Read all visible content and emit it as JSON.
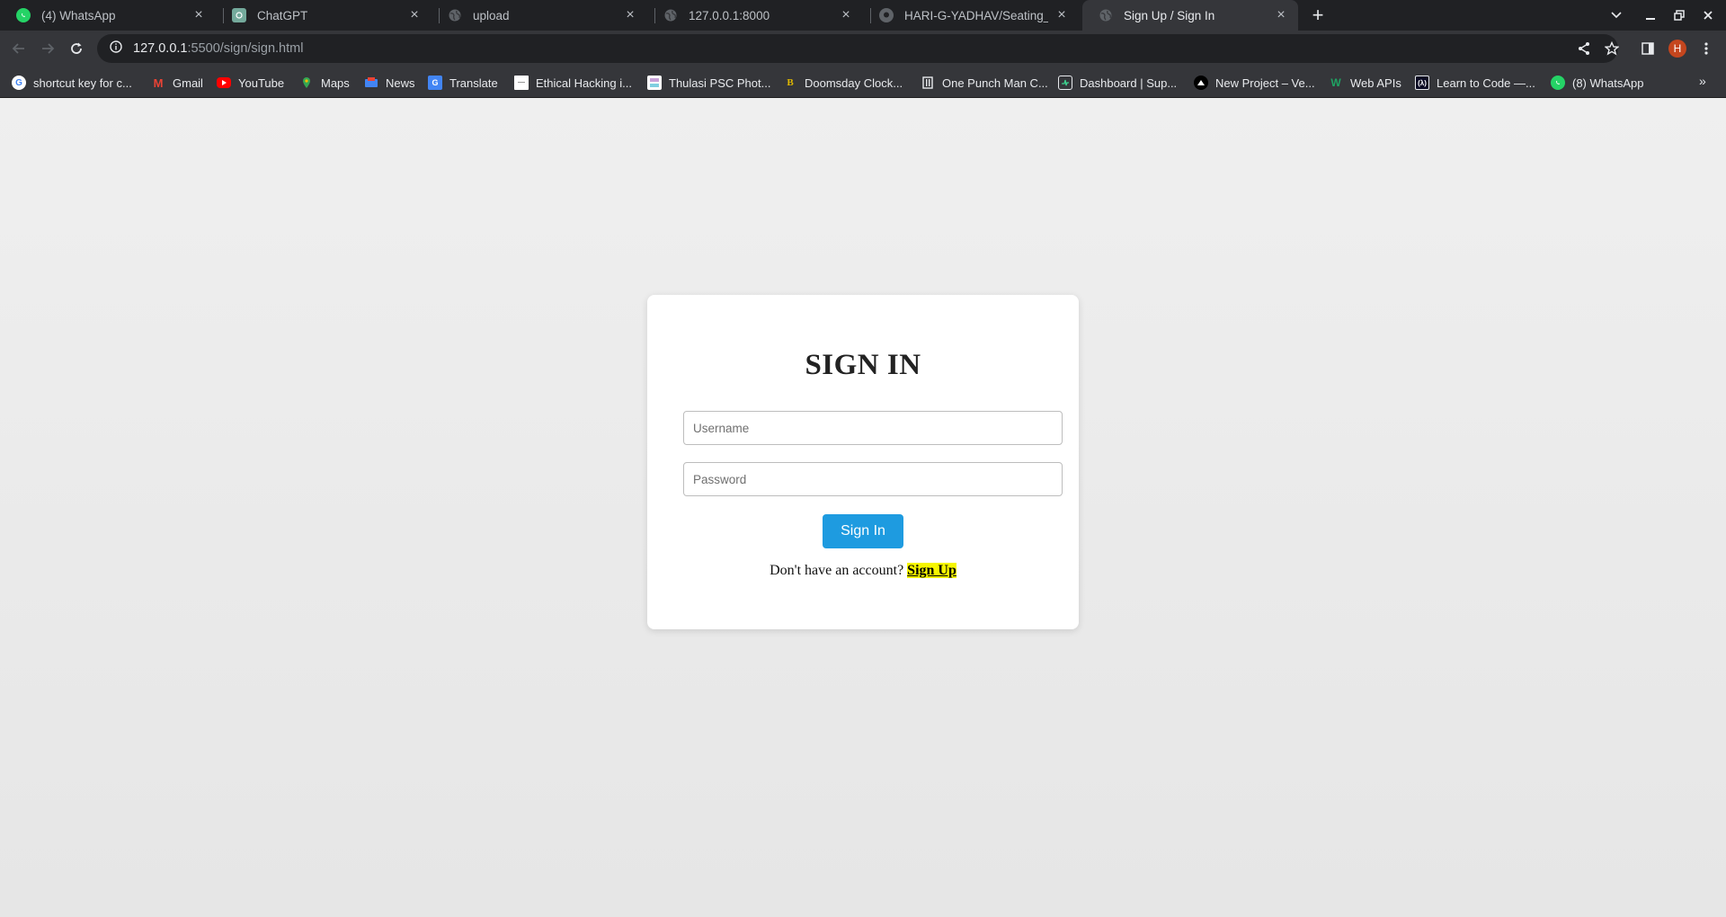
{
  "browser": {
    "tabs": [
      {
        "title": "(4) WhatsApp",
        "icon": "whatsapp-icon"
      },
      {
        "title": "ChatGPT",
        "icon": "chatgpt-icon"
      },
      {
        "title": "upload",
        "icon": "globe-icon"
      },
      {
        "title": "127.0.0.1:8000",
        "icon": "globe-icon"
      },
      {
        "title": "HARI-G-YADHAV/Seating_Arra",
        "icon": "github-icon"
      },
      {
        "title": "Sign Up / Sign In",
        "icon": "globe-icon",
        "active": true
      }
    ],
    "address": {
      "host": "127.0.0.1",
      "path": ":5500/sign/sign.html"
    },
    "profile_initial": "H",
    "bookmarks": [
      {
        "label": "shortcut key for c...",
        "icon": "google-icon"
      },
      {
        "label": "Gmail",
        "icon": "gmail-icon"
      },
      {
        "label": "YouTube",
        "icon": "youtube-icon"
      },
      {
        "label": "Maps",
        "icon": "maps-icon"
      },
      {
        "label": "News",
        "icon": "news-icon"
      },
      {
        "label": "Translate",
        "icon": "translate-icon"
      },
      {
        "label": "Ethical Hacking i...",
        "icon": "page-icon"
      },
      {
        "label": "Thulasi PSC Phot...",
        "icon": "psc-icon"
      },
      {
        "label": "Doomsday Clock...",
        "icon": "bulletin-icon"
      },
      {
        "label": "One Punch Man C...",
        "icon": "manga-icon"
      },
      {
        "label": "Dashboard | Sup...",
        "icon": "supabase-icon"
      },
      {
        "label": "New Project – Ve...",
        "icon": "vercel-icon"
      },
      {
        "label": "Web APIs",
        "icon": "webapis-icon"
      },
      {
        "label": "Learn to Code —...",
        "icon": "fcc-icon"
      },
      {
        "label": "(8) WhatsApp",
        "icon": "whatsapp-icon"
      }
    ]
  },
  "page": {
    "heading": "SIGN IN",
    "username_placeholder": "Username",
    "password_placeholder": "Password",
    "submit_label": "Sign In",
    "switch_text": "Don't have an account?",
    "switch_link": "Sign Up"
  },
  "colors": {
    "primary_button": "#1e9be0",
    "link_highlight": "#f6f600",
    "profile_avatar": "#c5461e"
  }
}
